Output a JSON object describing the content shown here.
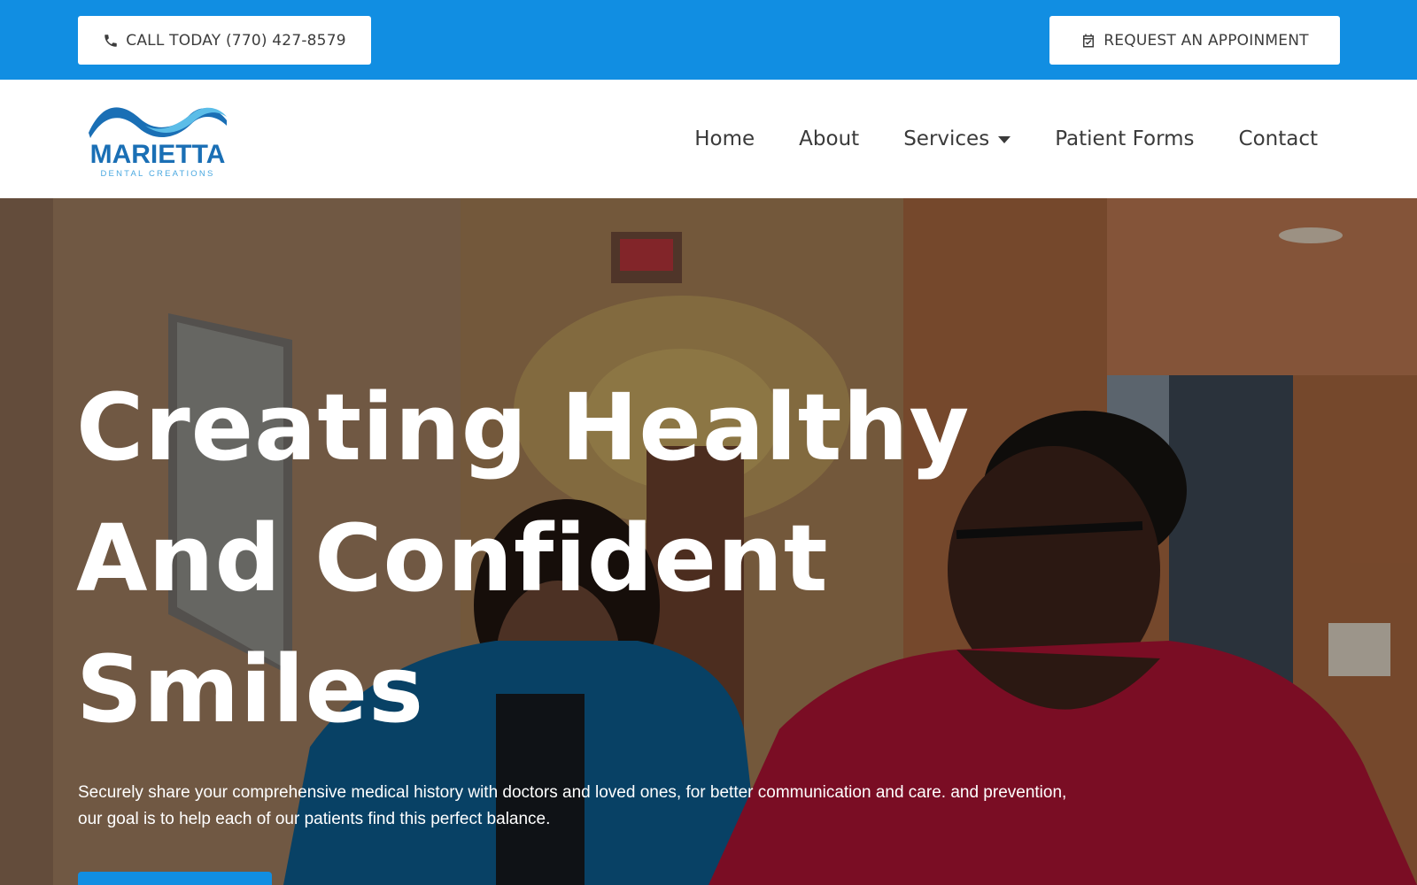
{
  "topbar": {
    "call_label": "CALL TODAY (770) 427-8579",
    "appointment_label": "REQUEST AN APPOINMENT",
    "background": "#118ee2",
    "icons": {
      "call": "phone-icon",
      "appointment": "calendar-check-icon"
    }
  },
  "logo": {
    "name": "MARIETTA",
    "tagline": "DENTAL CREATIONS",
    "colors": {
      "primary": "#1a6fb5",
      "secondary": "#5bbde8"
    }
  },
  "nav": {
    "items": [
      {
        "label": "Home"
      },
      {
        "label": "About"
      },
      {
        "label": "Services",
        "has_dropdown": true
      },
      {
        "label": "Patient Forms"
      },
      {
        "label": "Contact"
      }
    ]
  },
  "hero": {
    "title_lines": [
      "Creating Healthy",
      "And Confident",
      "Smiles"
    ],
    "subtitle": "Securely share your comprehensive medical history with doctors and loved ones, for better communication and care. and prevention, our goal is to help each of our patients find this perfect balance.",
    "cta_color": "#118ee2",
    "background_image": "photo of a dental office hallway with a dentist in blue scrubs and a smiling patient in a red top"
  }
}
